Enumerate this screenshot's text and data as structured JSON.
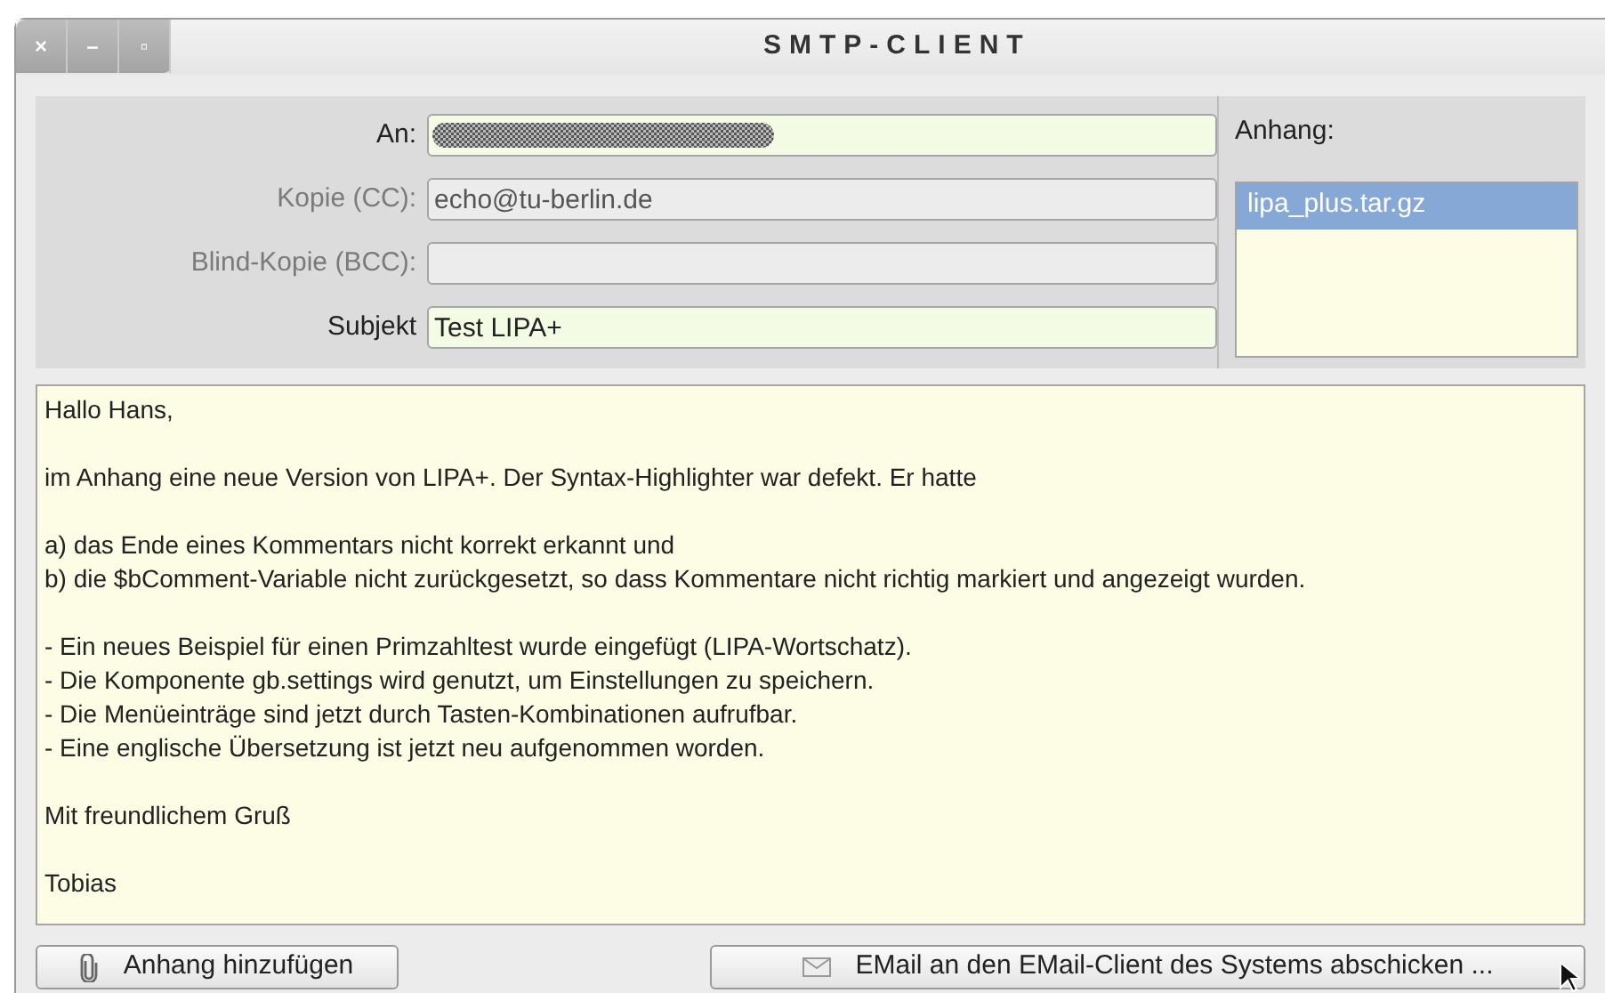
{
  "window": {
    "title": "SMTP-CLIENT",
    "controls": [
      "×",
      "–",
      "▫"
    ]
  },
  "fields": [
    {
      "label": "An:",
      "kind": "redacted",
      "disabled": false
    },
    {
      "label": "Kopie (CC):",
      "kind": "text",
      "value": "echo@tu-berlin.de",
      "disabled": true
    },
    {
      "label": "Blind-Kopie (BCC):",
      "kind": "text",
      "disabled": true
    },
    {
      "label": "Subjekt",
      "kind": "text",
      "value": "Test LIPA+",
      "disabled": false
    }
  ],
  "attachments": {
    "label": "Anhang:",
    "items": [
      {
        "name": "lipa_plus.tar.gz",
        "selected": true
      }
    ]
  },
  "body": {
    "paragraphs": [
      [
        "Hallo Hans,"
      ],
      [
        "im Anhang eine neue Version von LIPA+. Der Syntax-Highlighter war defekt. Er hatte"
      ],
      [
        "a) das Ende eines Kommentars nicht korrekt erkannt und",
        "b) die $bComment-Variable nicht zurückgesetzt, so dass Kommentare nicht richtig markiert und angezeigt wurden."
      ],
      [
        "- Ein neues Beispiel für einen Primzahltest wurde eingefügt (LIPA-Wortschatz).",
        "- Die Komponente gb.settings wird genutzt, um Einstellungen zu speichern.",
        "- Die Menüeinträge sind jetzt durch Tasten-Kombinationen aufrufbar.",
        "- Eine englische Übersetzung ist jetzt neu aufgenommen worden."
      ],
      [
        "Mit freundlichem Gruß"
      ],
      [
        "Tobias"
      ]
    ]
  },
  "buttons": [
    {
      "label": "Anhang hinzufügen",
      "kind": "attach"
    },
    {
      "label": "EMail an den EMail-Client des Systems abschicken ...",
      "kind": "send"
    }
  ]
}
